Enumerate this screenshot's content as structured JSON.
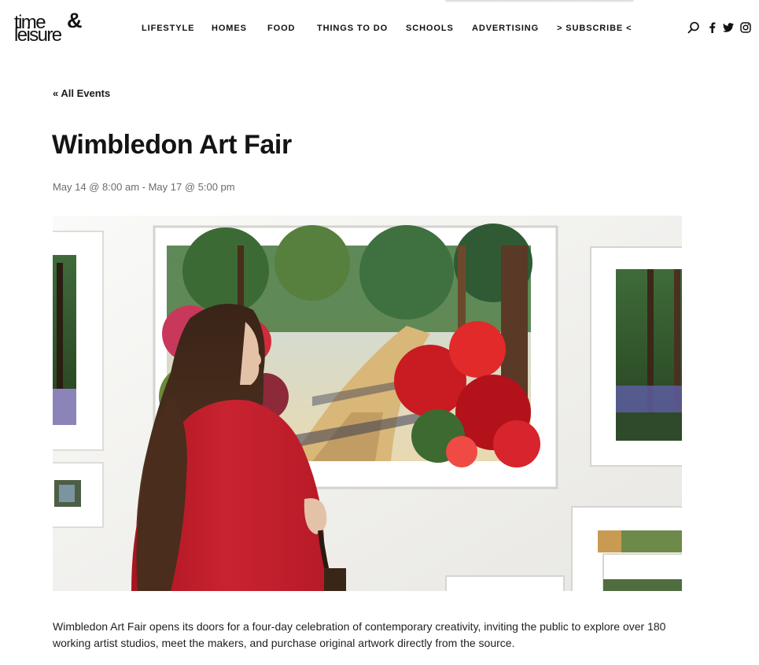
{
  "header": {
    "logo": {
      "line1": "time",
      "ampersand": "&",
      "line2": "leisure",
      "alt": "time & leisure"
    },
    "nav": [
      {
        "label": "LIFESTYLE"
      },
      {
        "label": "HOMES"
      },
      {
        "label": "FOOD"
      },
      {
        "label": "THINGS TO DO"
      },
      {
        "label": "SCHOOLS"
      },
      {
        "label": "ADVERTISING"
      },
      {
        "label": "> SUBSCRIBE <"
      }
    ],
    "tools": [
      {
        "icon": "search-icon"
      },
      {
        "icon": "facebook-icon"
      },
      {
        "icon": "twitter-icon"
      },
      {
        "icon": "instagram-icon"
      }
    ]
  },
  "event": {
    "back_link": "« All Events",
    "title": "Wimbledon Art Fair",
    "dates": "May 14 @ 8:00 am - May 17 @ 5:00 pm",
    "image_icon": "event-photo",
    "description": "Wimbledon Art Fair opens its doors for a four-day celebration of contemporary creativity, inviting the public to explore over 180 working artist studios, meet the makers, and purchase original artwork directly from the source."
  },
  "colors": {
    "text": "#141414",
    "muted": "#6c6c6c",
    "coat_red": "#c41f2a",
    "wall": "#f1f1ef"
  }
}
